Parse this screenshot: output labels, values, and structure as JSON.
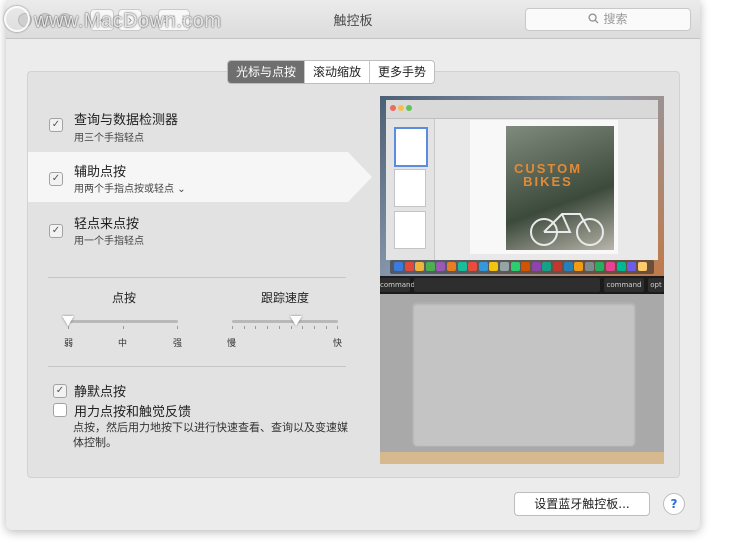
{
  "watermark": "www.MacDown.com",
  "window": {
    "title": "触控板"
  },
  "search": {
    "placeholder": "搜索",
    "icon": "magnifier-icon"
  },
  "nav": {
    "back": "‹",
    "forward": "›",
    "grid": "⋮⋮⋮"
  },
  "tabs": [
    {
      "label": "光标与点按",
      "active": true
    },
    {
      "label": "滚动缩放",
      "active": false
    },
    {
      "label": "更多手势",
      "active": false
    }
  ],
  "options": [
    {
      "title": "查询与数据检测器",
      "subtitle": "用三个手指轻点",
      "checked": true
    },
    {
      "title": "辅助点按",
      "subtitle": "用两个手指点按或轻点",
      "checked": true
    },
    {
      "title": "轻点来点按",
      "subtitle": "用一个手指轻点",
      "checked": true
    }
  ],
  "sliders": {
    "click": {
      "label": "点按",
      "min_label": "弱",
      "mid_label": "中",
      "max_label": "强",
      "value": 0
    },
    "tracking": {
      "label": "跟踪速度",
      "min_label": "慢",
      "max_label": "快",
      "value": 0.6
    }
  },
  "silent_click": {
    "label": "静默点按",
    "checked": true
  },
  "force_click": {
    "label": "用力点按和触觉反馈",
    "checked": false,
    "description": "点按，然后用力地按下以进行快速查看、查询以及变速媒体控制。"
  },
  "preview": {
    "magazine_title": "CUSTOM BIKES",
    "keys": [
      "command",
      "command",
      "opt"
    ]
  },
  "buttons": {
    "bluetooth": "设置蓝牙触控板...",
    "help": "?"
  },
  "colors": {
    "active_tab": "#6f6f6f",
    "accent_orange": "#e58a34",
    "help_blue": "#2b6fd6"
  }
}
